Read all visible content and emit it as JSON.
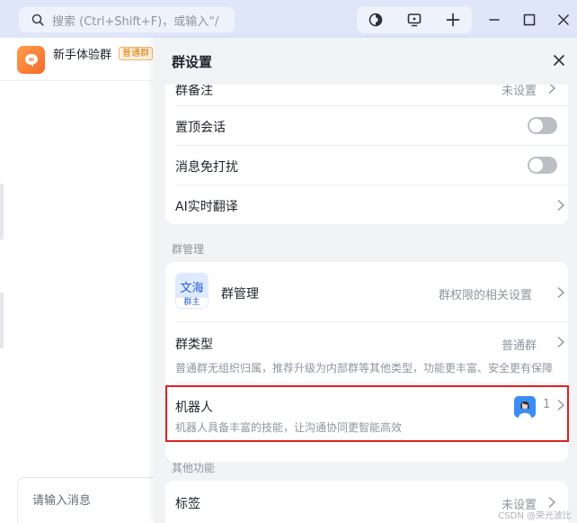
{
  "titlebar": {
    "search_placeholder": "搜索 (Ctrl+Shift+F)，或输入“/"
  },
  "chat": {
    "group_name": "新手体验群",
    "group_badge": "普通群",
    "input_placeholder": "请输入消息"
  },
  "panel": {
    "title": "群设置",
    "rows_top": [
      {
        "label": "群备注",
        "value": "未设置"
      },
      {
        "label": "置顶会话",
        "toggle": false
      },
      {
        "label": "消息免打扰",
        "toggle": false
      },
      {
        "label": "AI实时翻译"
      }
    ],
    "section_manage": "群管理",
    "group_manage": {
      "avatar_top": "文海",
      "avatar_bottom": "群主",
      "label": "群管理",
      "value": "群权限的相关设置"
    },
    "group_type": {
      "label": "群类型",
      "value": "普通群",
      "desc": "普通群无组织归属，推荐升级为内部群等其他类型，功能更丰富、安全更有保障"
    },
    "robot": {
      "label": "机器人",
      "count": "1",
      "desc": "机器人具备丰富的技能，让沟通协同更智能高效"
    },
    "section_other": "其他功能",
    "tags": {
      "label": "标签",
      "value": "未设置"
    }
  },
  "watermark": "CSDN @荣光波比",
  "colors": {
    "titlebar_bg": "#dfe6f8",
    "panel_bg": "#f2f3f5",
    "highlight": "#e02020",
    "accent": "#245bdb"
  }
}
